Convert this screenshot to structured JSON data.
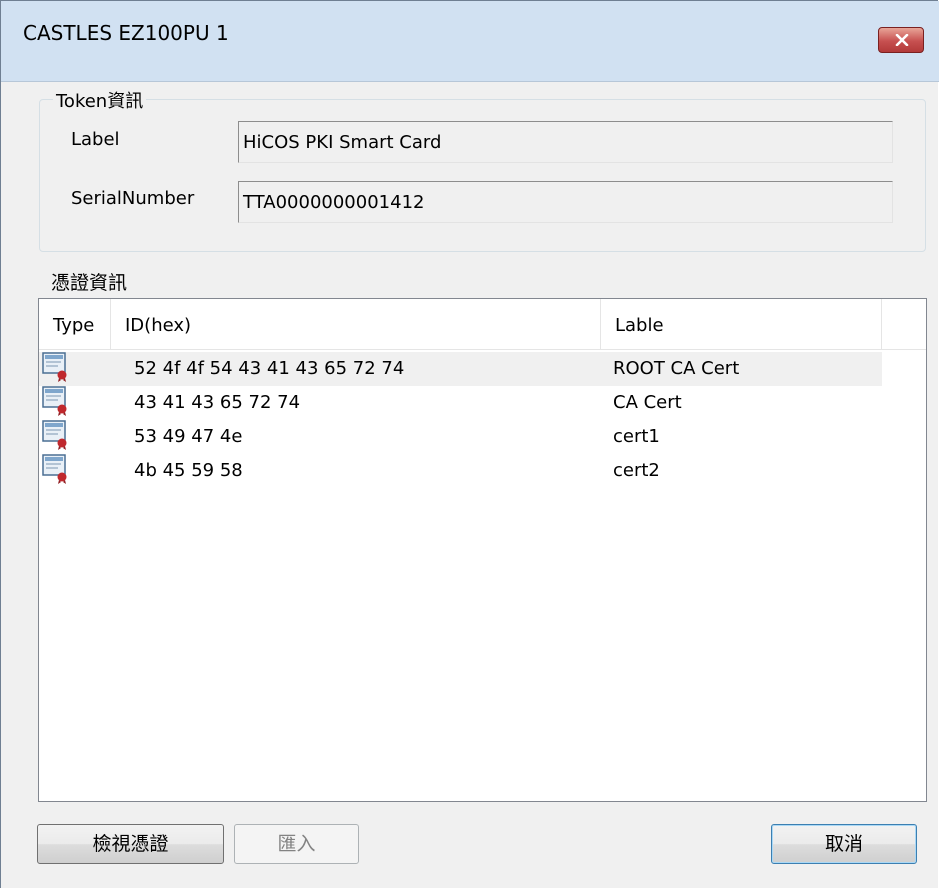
{
  "window": {
    "title": "CASTLES EZ100PU 1",
    "close_icon": "close-x-icon"
  },
  "token_group": {
    "legend": "Token資訊",
    "label_caption": "Label",
    "label_value": "HiCOS PKI Smart Card",
    "serial_caption": "SerialNumber",
    "serial_value": "TTA0000000001412"
  },
  "cert_section": {
    "heading": "憑證資訊",
    "columns": [
      "Type",
      "ID(hex)",
      "Lable"
    ],
    "rows": [
      {
        "icon": "certificate-icon",
        "id": "52 4f 4f 54 43 41 43 65 72 74",
        "label": "ROOT CA Cert",
        "selected": true
      },
      {
        "icon": "certificate-icon",
        "id": "43 41 43 65 72 74",
        "label": "CA Cert",
        "selected": false
      },
      {
        "icon": "certificate-icon",
        "id": "53 49 47 4e",
        "label": "cert1",
        "selected": false
      },
      {
        "icon": "certificate-icon",
        "id": "4b 45 59 58",
        "label": "cert2",
        "selected": false
      }
    ]
  },
  "buttons": {
    "view_cert": "檢視憑證",
    "import": "匯入",
    "cancel": "取消"
  }
}
